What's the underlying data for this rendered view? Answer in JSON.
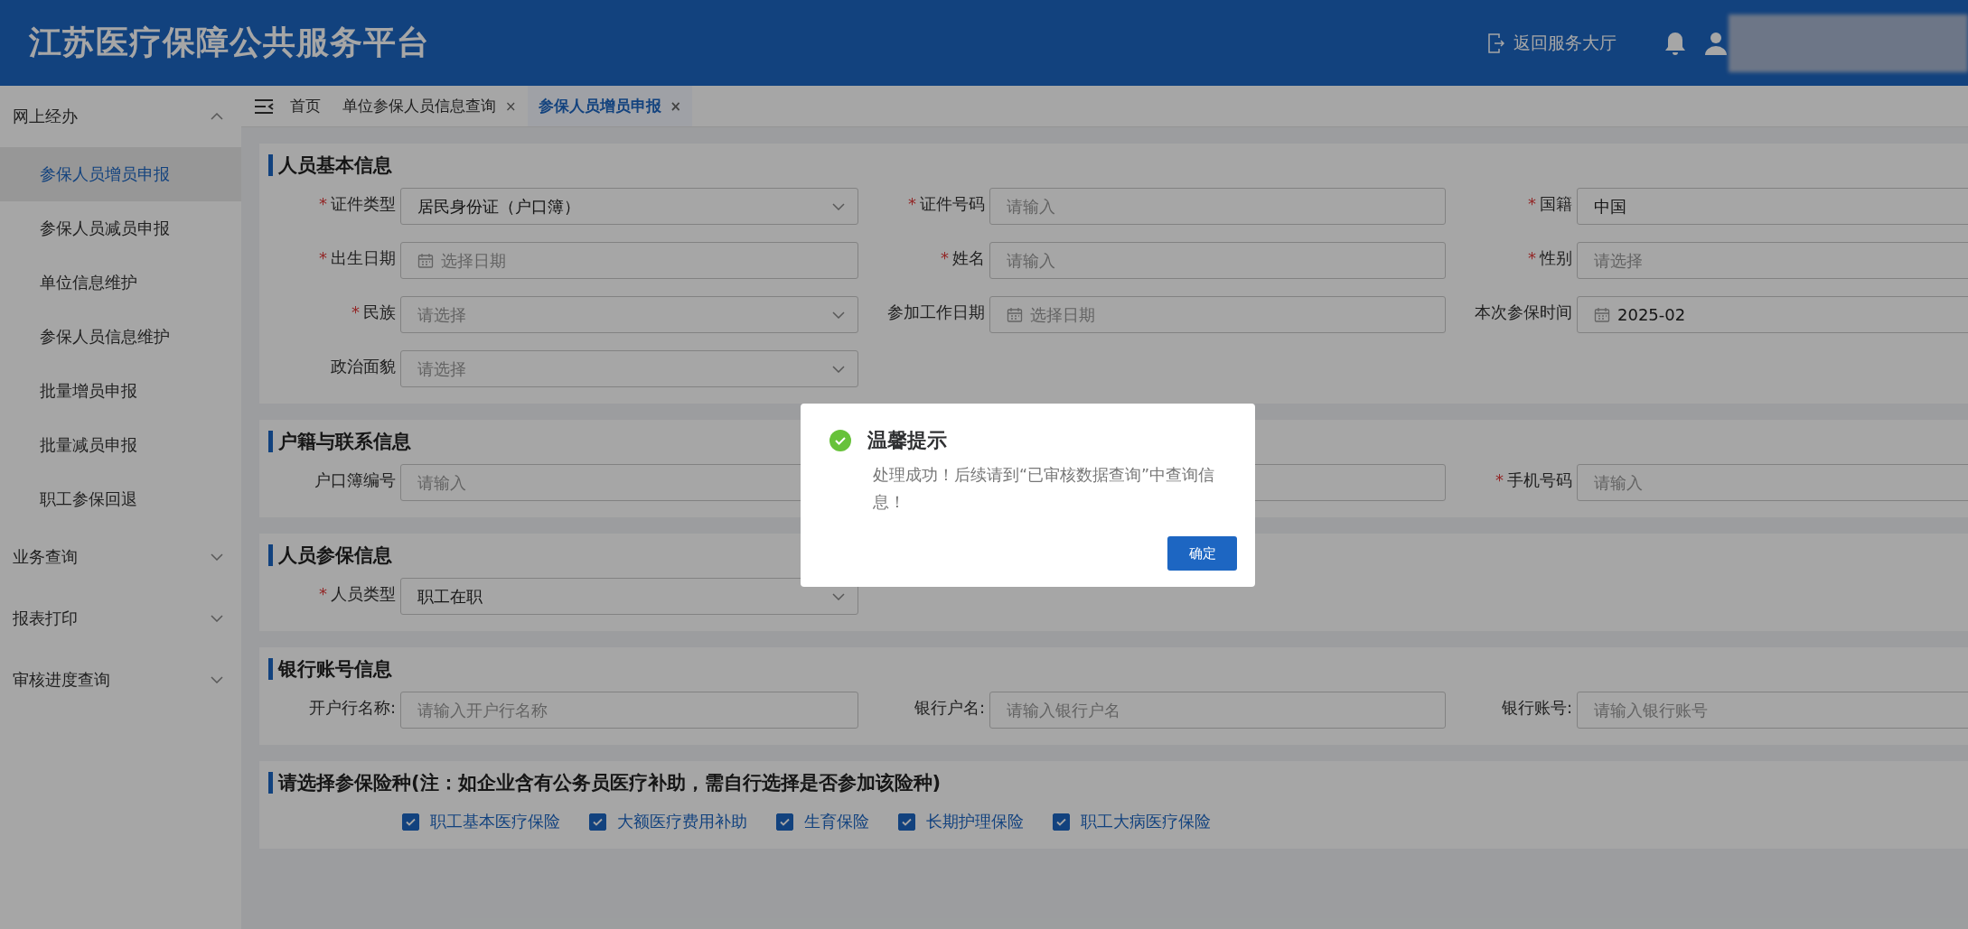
{
  "header": {
    "title": "江苏医疗保障公共服务平台",
    "back_link": "返回服务大厅"
  },
  "sidebar": {
    "groups": [
      {
        "label": "网上经办",
        "expanded": true,
        "children": [
          {
            "label": "参保人员增员申报",
            "selected": true
          },
          {
            "label": "参保人员减员申报",
            "selected": false
          },
          {
            "label": "单位信息维护",
            "selected": false
          },
          {
            "label": "参保人员信息维护",
            "selected": false
          },
          {
            "label": "批量增员申报",
            "selected": false
          },
          {
            "label": "批量减员申报",
            "selected": false
          },
          {
            "label": "职工参保回退",
            "selected": false
          }
        ]
      },
      {
        "label": "业务查询",
        "expanded": false
      },
      {
        "label": "报表打印",
        "expanded": false
      },
      {
        "label": "审核进度查询",
        "expanded": false
      }
    ]
  },
  "tabs": [
    {
      "label": "首页",
      "selected": false
    },
    {
      "label": "单位参保人员信息查询",
      "selected": false,
      "close": "×"
    },
    {
      "label": "参保人员增员申报",
      "selected": true,
      "close": "×"
    }
  ],
  "sections": [
    {
      "title": "人员基本信息",
      "fields": [
        {
          "label": "证件类型",
          "mark": "*",
          "kind": "select",
          "value": "居民身份证（户口簿）"
        },
        {
          "label": "证件号码",
          "mark": "*",
          "kind": "text",
          "placeholder": "请输入"
        },
        {
          "label": "国籍",
          "mark": "*",
          "kind": "text",
          "value": "中国"
        },
        {
          "label": "出生日期",
          "mark": "*",
          "kind": "date",
          "placeholder": "选择日期"
        },
        {
          "label": "姓名",
          "mark": "*",
          "kind": "text",
          "placeholder": "请输入"
        },
        {
          "label": "性别",
          "mark": "*",
          "kind": "text",
          "placeholder": "请选择"
        },
        {
          "label": "民族",
          "mark": "*",
          "kind": "select",
          "placeholder": "请选择"
        },
        {
          "label": "参加工作日期",
          "kind": "date",
          "placeholder": "选择日期"
        },
        {
          "label": "本次参保时间",
          "kind": "date",
          "value": "2025-02"
        },
        {
          "label": "政治面貌",
          "kind": "select",
          "placeholder": "请选择"
        }
      ]
    },
    {
      "title": "户籍与联系信息",
      "fields": [
        {
          "label": "户口簿编号",
          "kind": "text",
          "placeholder": "请输入"
        },
        {
          "kind": "text"
        },
        {
          "label": "手机号码",
          "mark": "*",
          "kind": "text",
          "placeholder": "请输入"
        }
      ]
    },
    {
      "title": "人员参保信息",
      "fields": [
        {
          "label": "人员类型",
          "mark": "*",
          "kind": "select",
          "value": "职工在职"
        }
      ]
    },
    {
      "title": "银行账号信息",
      "fields": [
        {
          "label": "开户行名称:",
          "kind": "text",
          "placeholder": "请输入开户行名称"
        },
        {
          "label": "银行户名:",
          "kind": "text",
          "placeholder": "请输入银行户名"
        },
        {
          "label": "银行账号:",
          "kind": "text",
          "placeholder": "请输入银行账号"
        }
      ]
    },
    {
      "title": "请选择参保险种(注：如企业含有公务员医疗补助，需自行选择是否参加该险种)",
      "checkboxes": [
        {
          "label": "职工基本医疗保险",
          "checked": true
        },
        {
          "label": "大额医疗费用补助",
          "checked": true
        },
        {
          "label": "生育保险",
          "checked": true
        },
        {
          "label": "长期护理保险",
          "checked": true
        },
        {
          "label": "职工大病医疗保险",
          "checked": true
        }
      ]
    }
  ],
  "dialog": {
    "title": "温馨提示",
    "message": "处理成功！后续请到“已审核数据查询”中查询信息！",
    "button": "确定"
  }
}
